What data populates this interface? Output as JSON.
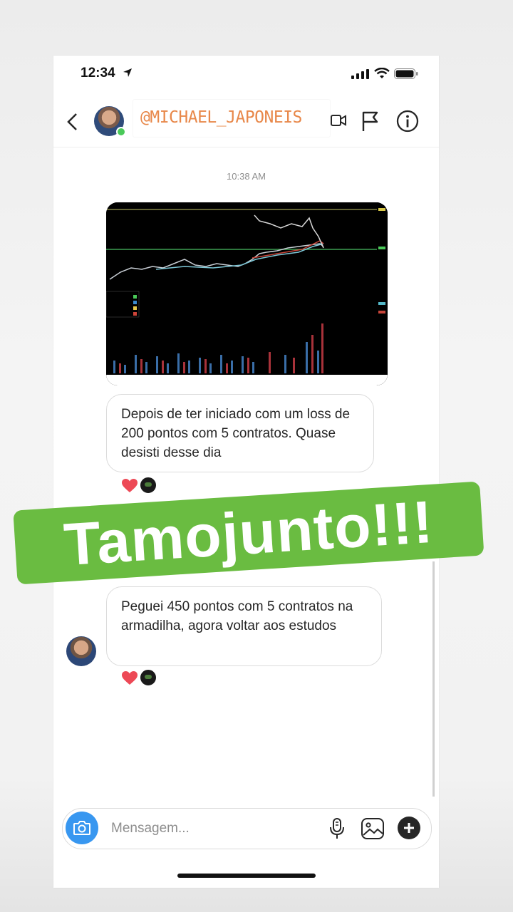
{
  "status_bar": {
    "time": "12:34"
  },
  "header": {
    "username": "@MICHAEL_JAPONEIS"
  },
  "chat": {
    "timestamp": "10:38 AM",
    "messages": [
      {
        "text": "Depois de ter iniciado com um loss de 200 pontos com 5 contratos. Quase desisti desse dia",
        "reactions": [
          "heart-icon",
          "reactor-avatar"
        ]
      },
      {
        "text": "Peguei 450 pontos com 5 contratos na armadilha, agora voltar aos estudos",
        "reactions": [
          "heart-icon",
          "reactor-avatar"
        ]
      }
    ]
  },
  "sticker": {
    "text": "Tamojunto!!!",
    "color": "#6abc41"
  },
  "composer": {
    "placeholder": "Mensagem..."
  },
  "colors": {
    "accent": "#3897f0",
    "heart": "#ed4956",
    "username": "#e8884a",
    "online": "#4ac959"
  }
}
